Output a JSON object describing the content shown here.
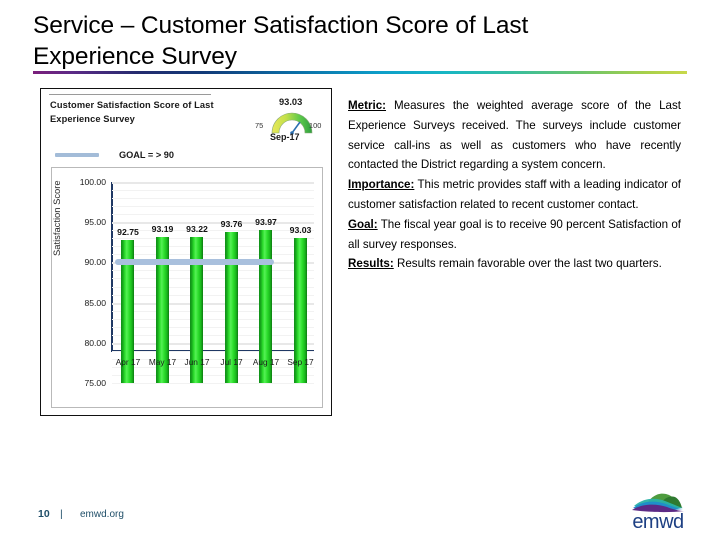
{
  "slide": {
    "title": "Service – Customer Satisfaction Score of Last Experience Survey",
    "accent_gradient_colors": [
      "#7b1f7b",
      "#242b6e",
      "#0d9ec9",
      "#6cc46a",
      "#c8d84a"
    ]
  },
  "chart_card": {
    "title": "Customer Satisfaction Score of Last Experience Survey",
    "legend_label": "GOAL = > 90",
    "legend_swatch_color": "#a3bcd8",
    "gauge": {
      "value": "93.03",
      "min": "75",
      "max": "100",
      "period": "Sep-17"
    }
  },
  "chart_data": {
    "type": "bar",
    "title": "Customer Satisfaction Score of Last Experience Survey",
    "xlabel": "",
    "ylabel": "Satisfaction Score",
    "categories": [
      "Apr 17",
      "May 17",
      "Jun 17",
      "Jul 17",
      "Aug 17",
      "Sep 17"
    ],
    "values": [
      92.75,
      93.19,
      93.22,
      93.76,
      93.97,
      93.03
    ],
    "value_labels": [
      "92.75",
      "93.19",
      "93.22",
      "93.76",
      "93.97",
      "93.03"
    ],
    "ylim": [
      75.0,
      100.0
    ],
    "ytick_labels": [
      "100.00",
      "95.00",
      "90.00",
      "85.00",
      "80.00",
      "75.00"
    ],
    "ytick_values": [
      100,
      95,
      90,
      85,
      80,
      75
    ],
    "grid": true,
    "legend_position": "top-left",
    "bar_color": "#2ee02e",
    "series": [
      {
        "name": "Satisfaction Score",
        "values": [
          92.75,
          93.19,
          93.22,
          93.76,
          93.97,
          93.03
        ]
      }
    ],
    "reference_line": {
      "label": "GOAL = > 90",
      "value": 90,
      "color": "#a9c0dd"
    }
  },
  "body": {
    "paragraphs": [
      {
        "lead": "Metric:",
        "text": " Measures the weighted average score of the Last Experience Surveys received. The surveys include customer service call-ins as well as customers who have recently contacted the District regarding a system concern."
      },
      {
        "lead": "Importance:",
        "text": " This metric provides staff with a leading indicator of customer satisfaction related to recent customer contact."
      },
      {
        "lead": "Goal:",
        "text": " The fiscal year goal is to receive 90 percent Satisfaction of all survey responses."
      },
      {
        "lead": "Results:",
        "text": " Results remain favorable over the last two quarters."
      }
    ]
  },
  "footer": {
    "page_number": "10",
    "separator": "|",
    "website": "emwd.org",
    "logo_wordmark": "emwd",
    "logo_colors": {
      "hill_green": "#4e9c3f",
      "hill_dark_green": "#2f7a30",
      "water_blue": "#1f8fc9",
      "water_teal": "#2ab2a6",
      "swoosh_purple": "#5c2a86",
      "wordmark": "#1d3f83"
    },
    "text_color": "#1f4e68"
  }
}
